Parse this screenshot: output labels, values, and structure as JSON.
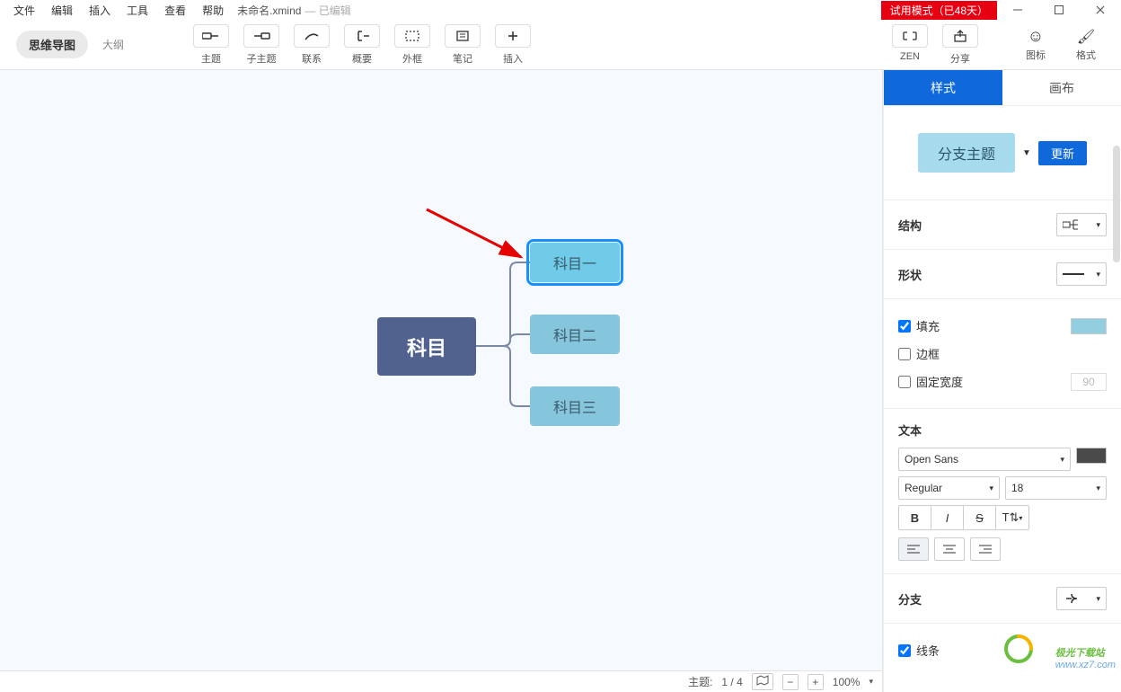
{
  "menu": {
    "file": "文件",
    "edit": "编辑",
    "insert": "插入",
    "tools": "工具",
    "view": "查看",
    "help": "帮助"
  },
  "doc": {
    "name": "未命名.xmind",
    "state": "— 已编辑"
  },
  "titlebar": {
    "trial": "试用模式（已48天）"
  },
  "tabs": {
    "mindmap": "思维导图",
    "outline": "大纲"
  },
  "toolbar": {
    "topic": "主题",
    "subtopic": "子主题",
    "relationship": "联系",
    "summary": "概要",
    "boundary": "外框",
    "notes": "笔记",
    "insert": "插入",
    "zen": "ZEN",
    "share": "分享",
    "icons": "图标",
    "format": "格式"
  },
  "mindmap": {
    "root": "科目",
    "c1": "科目一",
    "c2": "科目二",
    "c3": "科目三"
  },
  "status": {
    "topic_label": "主题:",
    "topic_value": "1 / 4",
    "zoom": "100%"
  },
  "panel": {
    "tab_style": "样式",
    "tab_canvas": "画布",
    "branch_topic": "分支主题",
    "update": "更新",
    "structure": "结构",
    "shape": "形状",
    "fill": "填充",
    "border": "边框",
    "fixed_width": "固定宽度",
    "fixed_width_value": "90",
    "text": "文本",
    "font_family": "Open Sans",
    "font_weight": "Regular",
    "font_size": "18",
    "branch": "分支",
    "line": "线条",
    "fill_color": "#93cde0",
    "text_color": "#4a4a4a"
  },
  "watermark": {
    "brand": "极光下载站",
    "url": "www.xz7.com"
  }
}
